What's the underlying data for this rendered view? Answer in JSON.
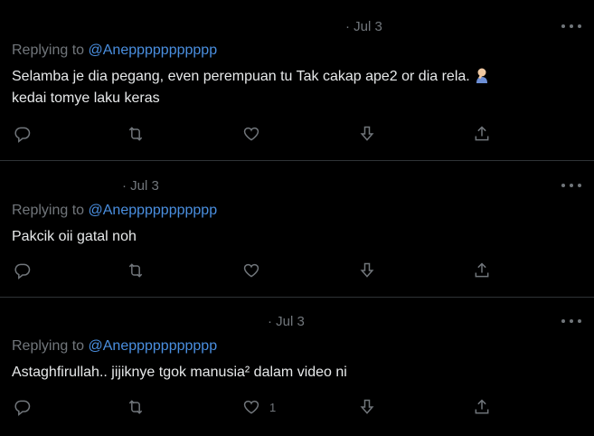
{
  "tweets": [
    {
      "date": "· Jul 3",
      "replying_prefix": "Replying to ",
      "handle": "@Aneppppppppppp",
      "lines": [
        "Selamba je dia pegang, even perempuan tu Tak cakap ape2 or dia rela.",
        "kedai tomye laku keras"
      ],
      "emoji": "person-facepalming-emoji",
      "like_count": ""
    },
    {
      "date": "· Jul 3",
      "replying_prefix": "Replying to ",
      "handle": "@Aneppppppppppp",
      "lines": [
        "Pakcik oii gatal noh"
      ],
      "like_count": ""
    },
    {
      "date": "· Jul 3",
      "replying_prefix": "Replying to ",
      "handle": "@Aneppppppppppp",
      "lines": [
        "Astaghfirullah.. jijiknye tgok manusia² dalam video ni"
      ],
      "like_count": "1"
    }
  ],
  "icons": {
    "reply": "reply-icon",
    "retweet": "retweet-icon",
    "like": "heart-icon",
    "dislike": "arrow-down-icon",
    "share": "share-icon",
    "more": "more-icon"
  },
  "colors": {
    "background": "#000000",
    "text": "#e7e9ea",
    "muted": "#71767b",
    "handle": "#4a8fe0",
    "divider": "#2f3336"
  }
}
